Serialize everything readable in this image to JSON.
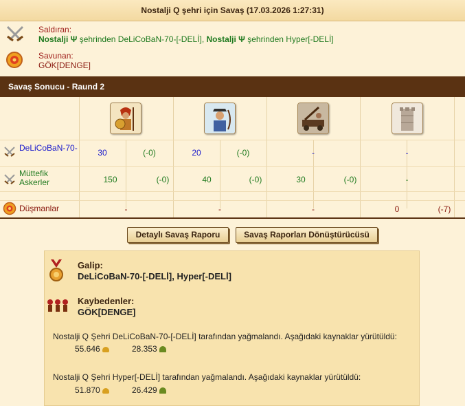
{
  "title": "Nostalji Q şehri için Savaş (17.03.2026 1:27:31)",
  "attacker": {
    "label": "Saldıran:",
    "city1": "Nostalji Ψ",
    "mid1": "şehrinden DeLiCoBaN-70-[-DELİ],",
    "city2": "Nostalji Ψ",
    "mid2": "şehrinden Hyper[-DELİ]"
  },
  "defender": {
    "label": "Savunan:",
    "name": "GÖK[DENGE]"
  },
  "round_title": "Savaş Sonucu - Raund 2",
  "units": [
    "hoplite-unit-icon",
    "archer-unit-icon",
    "catapult-unit-icon",
    "wall-unit-icon"
  ],
  "rows": [
    {
      "name": "DeLiCoBaN-70-",
      "icon": "crossed-swords-icon",
      "cells": [
        {
          "count": "30",
          "loss": "(-0)"
        },
        {
          "count": "20",
          "loss": "(-0)"
        },
        {
          "count": "-",
          "loss": ""
        },
        {
          "count": "-",
          "loss": ""
        }
      ]
    },
    {
      "name": "Müttefik Askerler",
      "icon": "crossed-swords-icon",
      "cells": [
        {
          "count": "150",
          "loss": "(-0)"
        },
        {
          "count": "40",
          "loss": "(-0)"
        },
        {
          "count": "30",
          "loss": "(-0)"
        },
        {
          "count": "-",
          "loss": ""
        }
      ]
    },
    {
      "name": "Düşmanlar",
      "icon": "shield-icon",
      "cells": [
        {
          "count": "-",
          "loss": ""
        },
        {
          "count": "-",
          "loss": ""
        },
        {
          "count": "-",
          "loss": ""
        },
        {
          "count": "0",
          "loss": "(-7)"
        }
      ]
    }
  ],
  "buttons": {
    "detail": "Detaylı Savaş Raporu",
    "converter": "Savaş Raporları Dönüştürücüsü"
  },
  "report": {
    "winner_label": "Galip:",
    "winner_value": "DeLiCoBaN-70-[-DELİ], Hyper[-DELİ]",
    "loser_label": "Kaybedenler:",
    "loser_value": "GÖK[DENGE]",
    "loot": [
      {
        "text": "Nostalji Q Şehri DeLiCoBaN-70-[-DELİ] tarafından yağmalandı. Aşağıdaki kaynaklar yürütüldü:",
        "gold": "55.646",
        "grain": "28.353"
      },
      {
        "text": "Nostalji Q Şehri Hyper[-DELİ] tarafından yağmalandı. Aşağıdaki kaynaklar yürütüldü:",
        "gold": "51.870",
        "grain": "26.429"
      }
    ]
  },
  "colors": {
    "round_bar": "#5a3212",
    "attacker_name": "#1a1acc",
    "ally_name": "#1f7a1f",
    "enemy_name": "#8a1a10"
  }
}
